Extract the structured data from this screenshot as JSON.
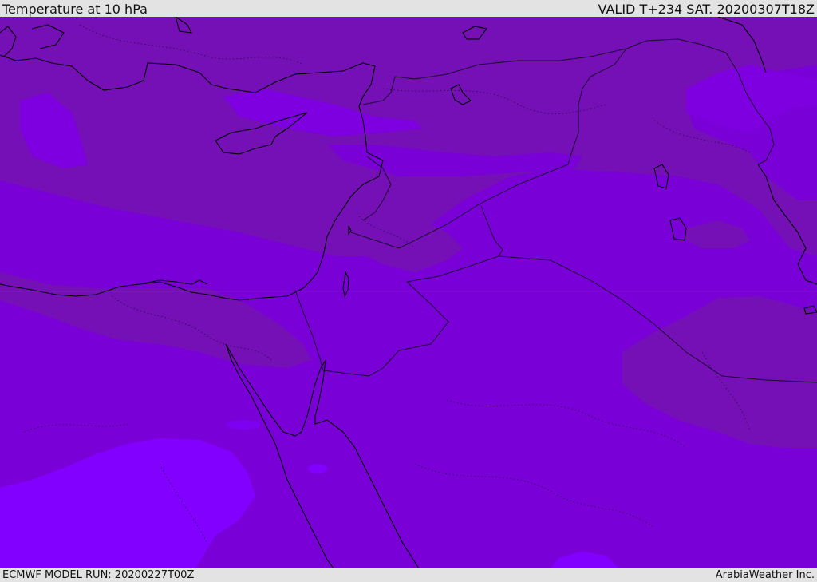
{
  "header": {
    "title": "Temperature at 10 hPa",
    "valid_time": "VALID T+234 SAT. 20200307T18Z"
  },
  "footer": {
    "model_run": "ECMWF MODEL RUN: 20200227T00Z",
    "credit": "ArabiaWeather Inc."
  },
  "map": {
    "colors": {
      "band_dark": "#7410b6",
      "band_mid": "#7a00d8",
      "band_light": "#7e00f0",
      "band_lightest": "#8200ff",
      "coastline": "#000000",
      "border": "#1a0a2e"
    }
  }
}
